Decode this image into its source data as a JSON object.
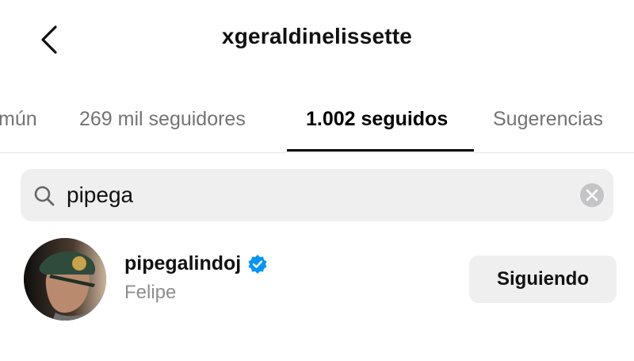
{
  "header": {
    "title": "xgeraldinelissette",
    "back_icon": "chevron-left-icon"
  },
  "tabs": [
    {
      "label": "mún",
      "active": false
    },
    {
      "label": "269 mil seguidores",
      "active": false
    },
    {
      "label": "1.002 seguidos",
      "active": true
    },
    {
      "label": "Sugerencias",
      "active": false
    }
  ],
  "search": {
    "value": "pipega",
    "icon": "search-icon",
    "clear_icon": "clear-circle-icon"
  },
  "results": [
    {
      "username": "pipegalindoj",
      "verified": true,
      "full_name": "Felipe",
      "button_label": "Siguiendo"
    }
  ],
  "colors": {
    "verified_blue": "#0095f6",
    "secondary_text": "#8e8e8e",
    "surface": "#efeff0"
  }
}
